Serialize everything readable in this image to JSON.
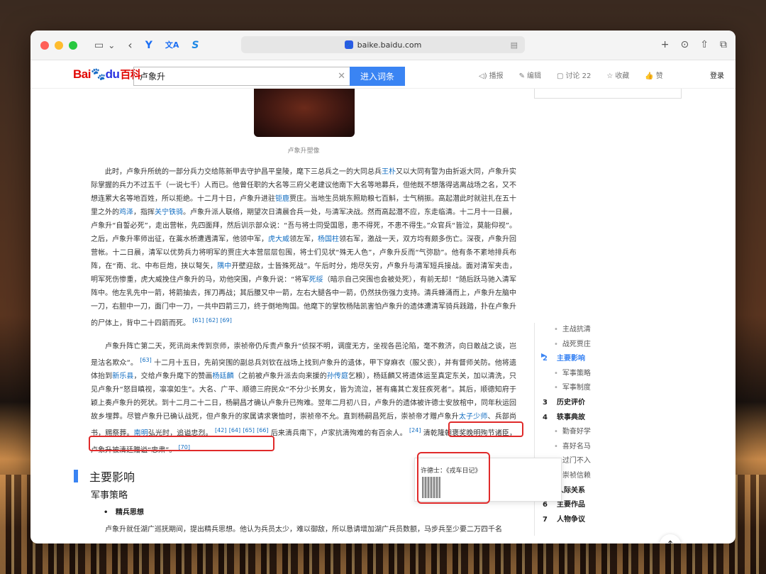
{
  "browser": {
    "url": "baike.baidu.com",
    "icons": [
      "sidebar-icon",
      "back-icon",
      "ext-y-icon",
      "translate-icon",
      "ext-s-icon",
      "add-tab-icon",
      "download-icon",
      "share-icon",
      "tabs-icon"
    ],
    "ext1_glyph": "Y",
    "ext2_glyph": "文A",
    "ext3_glyph": "S"
  },
  "header": {
    "logo_bai": "Bai",
    "logo_du": "du",
    "logo_baike": "百科",
    "search_value": "卢象升",
    "enter_label": "进入词条",
    "actions": {
      "play": "播报",
      "edit": "编辑",
      "discuss": "讨论 22",
      "collect": "收藏",
      "like": "赞"
    },
    "login": "登录"
  },
  "article": {
    "caption": "卢象升塑像",
    "p1": {
      "a": "此时，卢象升所统的一部分兵力交给陈新甲去守护昌平皇陵，麾下三总兵之一的大同总兵",
      "link1": "王朴",
      "b": "又以大同有警为由折返大同，卢象升实际掌握的兵力不过五千（一说七千）人而已。他曾任职的大名等三府父老建议他南下大名等地募兵，但他既不想落得逃离战场之名，又不想连累大名等地百姓，所以拒绝。十二月十日，卢象升进驻",
      "link2": "钜鹿",
      "c": "贾庄。当地生员姚东照助粮七百斛，士气稍振。高起潜此时就驻扎在五十里之外的",
      "link3": "鸡泽",
      "d": "，指挥",
      "link4": "关宁铁骑",
      "e": "。卢象升派人联络，期望次日清晨合兵一处，与清军决战。然而高起潜不应，东走临清。十二月十一日晨，卢象升“自誓必死”，走出营帐，先四面拜，然后训示部众说：“吾与将士同受国恩，患不得死，不患不得生。”众官兵“皆泣，莫能仰视”。之后，卢象升率师出征，在蒿水桥遭遇清军，他领中军，",
      "link5": "虎大威",
      "f": "领左军，",
      "link6": "杨国柱",
      "g": "领右军，激战一天，双方均有颇多伤亡。深夜，卢象升回营帐。十二日晨，清军以优势兵力将明军的贾庄大本营层层包围，将士们见状“殊无人色”，卢象升反而“气弥励”。他有条不紊地排兵布阵，在“南、北、中布巨炮，挟以弩矢，",
      "link7": "隅中",
      "h": "开壁迎敌，士皆殊死战”。午后时分，炮尽矢穷，卢象升与清军短兵接战。面对清军夹击，明军死伤惨重，虎大威挽住卢象升的马，劝他突围，卢象升说：“将军",
      "link8": "死绥",
      "i": "（暗示自己突围也会被处死），有前无却！”随后跃马驰入清军阵中。他左乳先中一箭，将箭抽去，挥刀再战；其后腰又中一箭，左右大腿各中一箭，仍然扶伤强力支持。清兵蜂涌而上，卢象升左脑中一刀，右胆中一刀，面门中一刀，一共中四箭三刀，终于倒地殉国。他麾下的掌牧杨陆凯害怕卢象升的遗体遭清军骑兵践踏，扑在卢象升的尸体上，背中二十四箭而死。",
      "ref1": "[61]",
      "ref2": "[62]",
      "ref3": "[69]"
    },
    "p2": {
      "a": "卢象升阵亡第二天，死讯尚未传到京师，崇祯帝仍斥责卢象升“侦探不明，调度无方，坐视各邑沦陷，毫不救济，向日敢战之谈，岂是沽名欺众”。",
      "ref1": "[63]",
      "b": "十二月十五日，先前突围的副总兵刘钦在战场上找到卢象升的遗体，甲下穿麻衣（服父丧），并有督师关防。他将遗体抬到",
      "link1": "新乐县",
      "c": "，交给卢象升麾下的赞画",
      "link2": "杨廷麟",
      "d": "（之前被卢象升派去向来援的",
      "link3": "孙传庭",
      "e": "乞粮），杨廷麟又将遗体运至真定东关，加以清洗，只见卢象升“怒目瞋视，凛凛如生”。大名、广平、顺德三府民众“不分少长男女，皆为流泣，甚有痛其亡发狂疾死者”。其后，顺德知府于颖上奏卢象升的死状。到十二月二十二日，杨嗣昌才确认卢象升已殉难。",
      "hl": "翌年二月初八日，卢象升的遗体被许德士安放棺中，同年秋运回故乡埋葬。",
      "f": "尽管卢象升已确认战死，但卢象升的家属请求褒恤时，崇祯帝不允。直到杨嗣昌死后，崇祯帝才赠卢象升",
      "link4": "太子少师",
      "g": "、兵部尚书，赐祭葬。",
      "link5": "南明",
      "h": "弘光时，追谥忠烈。",
      "ref2": "[42]",
      "ref3": "[64]",
      "ref4": "[65]",
      "ref5": "[66]",
      "i": "后来清兵南下，卢家抗清殉难的有百余人。",
      "ref6": "[24]",
      "j": "清乾隆朝褒奖晚明殉节诸臣，卢象升被清廷赠谥“忠肃”。",
      "ref7": "[70]"
    },
    "h2": "主要影响",
    "h3": "军事策略",
    "bullet": "精兵思想",
    "p3": "卢象升就任湖广巡抚期间，提出精兵思想。他认为兵员太少，难以御敌，所以恳请增加湖广兵员数额，马步兵至少要二万四千名"
  },
  "popup": {
    "title": "许德士：《戎车日记》"
  },
  "toc": [
    {
      "label": "主战抗清",
      "type": "sub"
    },
    {
      "label": "战死贾庄",
      "type": "sub"
    },
    {
      "num": "2",
      "label": "主要影响",
      "type": "main",
      "active": true
    },
    {
      "label": "军事策略",
      "type": "sub"
    },
    {
      "label": "军事制度",
      "type": "sub"
    },
    {
      "num": "3",
      "label": "历史评价",
      "type": "main"
    },
    {
      "num": "4",
      "label": "轶事典故",
      "type": "main"
    },
    {
      "label": "勤奋好学",
      "type": "sub"
    },
    {
      "label": "喜好名马",
      "type": "sub"
    },
    {
      "label": "过门不入",
      "type": "sub"
    },
    {
      "label": "崇祯信赖",
      "type": "sub"
    },
    {
      "num": "5",
      "label": "人际关系",
      "type": "main"
    },
    {
      "num": "6",
      "label": "主要作品",
      "type": "main"
    },
    {
      "num": "7",
      "label": "人物争议",
      "type": "main"
    }
  ]
}
